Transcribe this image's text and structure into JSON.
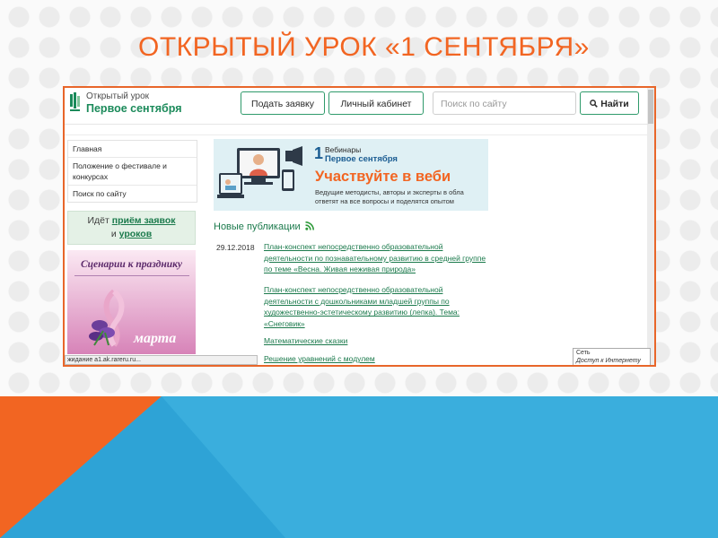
{
  "slide": {
    "title": "ОТКРЫТЫЙ УРОК «1 СЕНТЯБРЯ»",
    "accent_color": "#f26522",
    "bottom_colors": [
      "#f26522",
      "#3aaedd",
      "#1c8ec2"
    ]
  },
  "site": {
    "logo_small": "Открытый урок",
    "logo_big": "Первое сентября",
    "header": {
      "apply_label": "Подать заявку",
      "cabinet_label": "Личный кабинет",
      "search_placeholder": "Поиск по сайту",
      "find_label": "Найти"
    },
    "nav": {
      "items": [
        "Главная",
        "Положение о фестивале и конкурсах",
        "Поиск по сайту"
      ]
    },
    "banner": {
      "prefix": "Идёт",
      "link1": "приём заявок",
      "and": "и",
      "link2": "уроков"
    },
    "promo": {
      "title": "Сценарии к празднику",
      "caption": "марта"
    },
    "webinar": {
      "logo_one": "1",
      "logo_small": "Вебинары",
      "logo_sub": "Первое сентября",
      "headline": "Участвуйте в веби",
      "desc_line1": "Ведущие методисты, авторы и эксперты в обла",
      "desc_line2": "ответят на все вопросы и поделятся опытом"
    },
    "publications": {
      "title": "Новые публикации",
      "date": "29.12.2018",
      "links": [
        "План-конспект непосредственно образовательной деятельности по познавательному развитию в средней группе по теме «Весна. Живая неживая природа»",
        "План-конспект непосредственно образовательной деятельности с дошкольниками младшей группы по художественно-эстетическому развитию (лепка). Тема: «Снеговик»",
        "Математические сказки",
        "Решение уравнений с модулем"
      ]
    },
    "status_text": "жидание a1.ak.rareru.ru...",
    "network": {
      "title": "Сеть",
      "subtitle": "Доступ к Интернету"
    },
    "icons": [
      "logo-icon",
      "search-icon",
      "rss-icon",
      "webinar-illustration",
      "flower-illustration"
    ]
  }
}
